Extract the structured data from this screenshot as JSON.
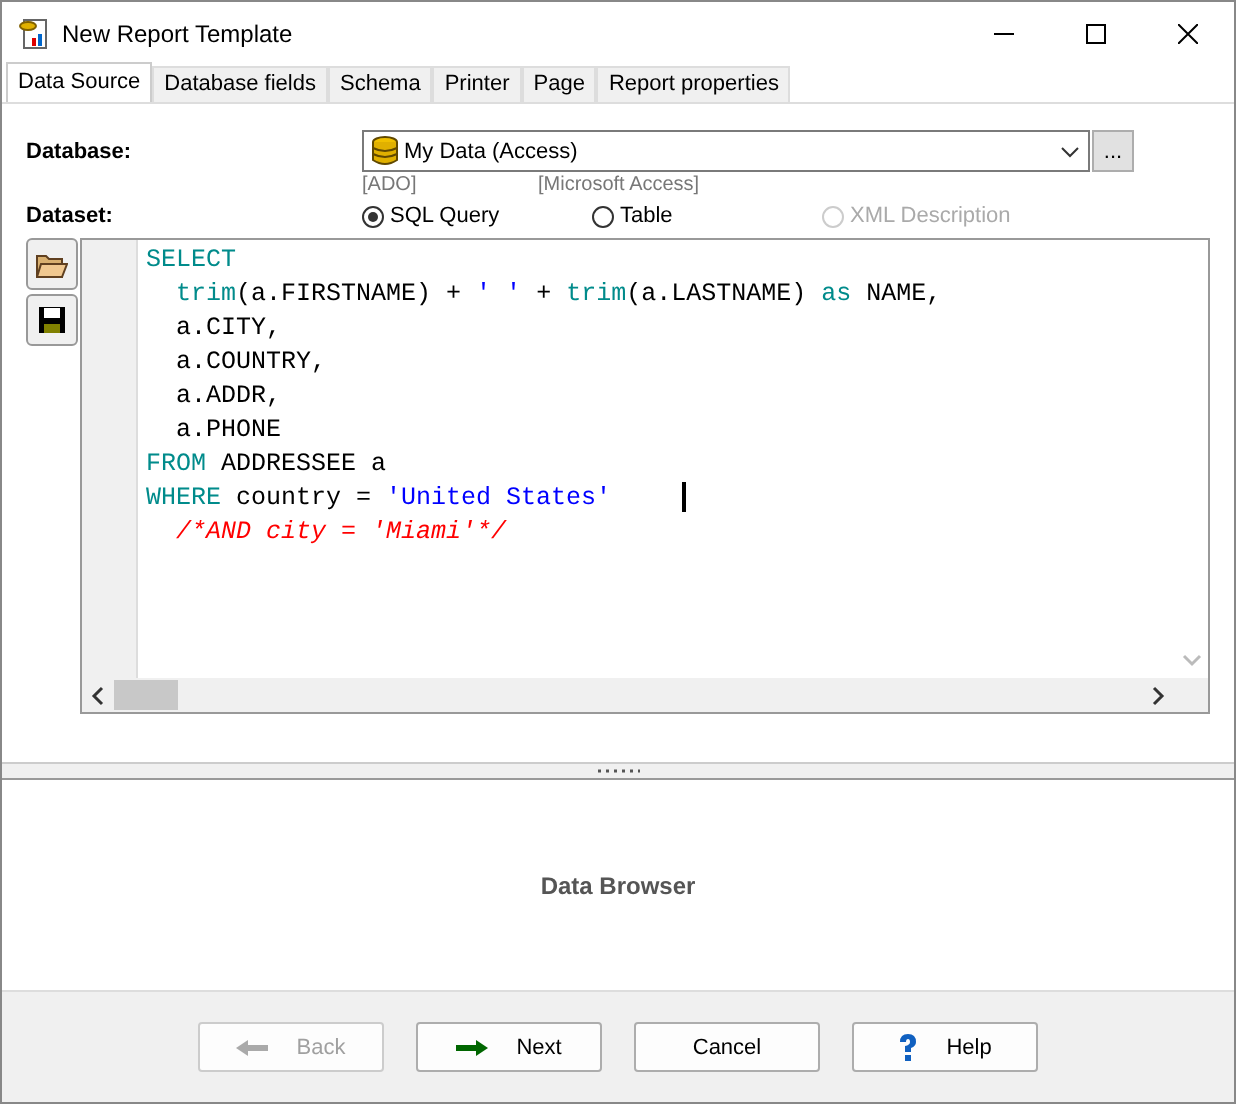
{
  "window": {
    "title": "New Report Template"
  },
  "tabs": [
    {
      "label": "Data Source",
      "selected": true
    },
    {
      "label": "Database fields",
      "selected": false
    },
    {
      "label": "Schema",
      "selected": false
    },
    {
      "label": "Printer",
      "selected": false
    },
    {
      "label": "Page",
      "selected": false
    },
    {
      "label": "Report properties",
      "selected": false
    }
  ],
  "database": {
    "label": "Database:",
    "value": "My Data (Access)",
    "browse": "...",
    "provider": "[ADO]",
    "driver": "[Microsoft Access]"
  },
  "dataset": {
    "label": "Dataset:",
    "options": [
      {
        "label": "SQL Query",
        "selected": true,
        "disabled": false
      },
      {
        "label": "Table",
        "selected": false,
        "disabled": false
      },
      {
        "label": "XML Description",
        "selected": false,
        "disabled": true
      }
    ]
  },
  "editor": {
    "lines": [
      [
        {
          "kind": "keyword",
          "text": "SELECT"
        }
      ],
      [
        {
          "kind": "function",
          "text": "  trim"
        },
        {
          "kind": "plain",
          "text": "(a.FIRSTNAME) + "
        },
        {
          "kind": "string",
          "text": "' '"
        },
        {
          "kind": "plain",
          "text": " + "
        },
        {
          "kind": "function",
          "text": "trim"
        },
        {
          "kind": "plain",
          "text": "(a.LASTNAME) "
        },
        {
          "kind": "keyword",
          "text": "as"
        },
        {
          "kind": "plain",
          "text": " NAME,"
        }
      ],
      [
        {
          "kind": "plain",
          "text": "  a.CITY,"
        }
      ],
      [
        {
          "kind": "plain",
          "text": "  a.COUNTRY,"
        }
      ],
      [
        {
          "kind": "plain",
          "text": "  a.ADDR,"
        }
      ],
      [
        {
          "kind": "plain",
          "text": "  a.PHONE"
        }
      ],
      [
        {
          "kind": "keyword",
          "text": "FROM"
        },
        {
          "kind": "plain",
          "text": " ADDRESSEE a"
        }
      ],
      [
        {
          "kind": "keyword",
          "text": "WHERE"
        },
        {
          "kind": "plain",
          "text": " country = "
        },
        {
          "kind": "string",
          "text": "'United States'"
        }
      ],
      [
        {
          "kind": "comment",
          "text": "  /*AND city = 'Miami'*/"
        }
      ]
    ]
  },
  "data_browser": {
    "label": "Data Browser"
  },
  "buttons": [
    {
      "kind": "back",
      "label": "Back",
      "disabled": true
    },
    {
      "kind": "next",
      "label": "Next",
      "disabled": false
    },
    {
      "kind": "cancel",
      "label": "Cancel",
      "disabled": false
    },
    {
      "kind": "help",
      "label": "Help",
      "disabled": false
    }
  ]
}
